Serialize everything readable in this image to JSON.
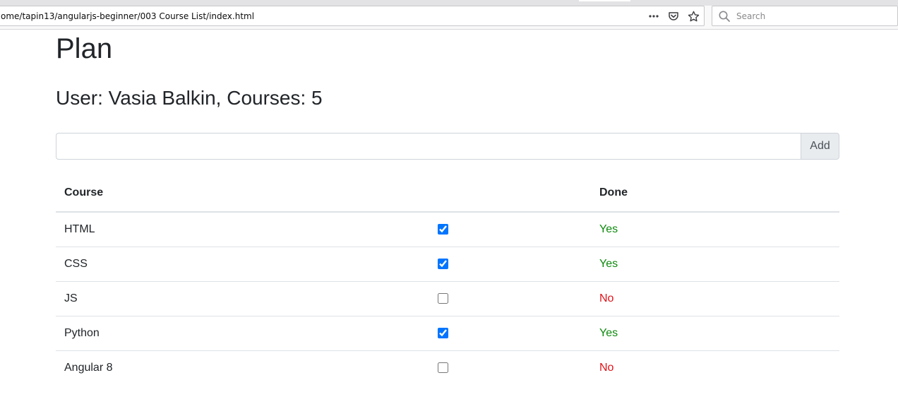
{
  "browser": {
    "url": "ome/tapin13/angularjs-beginner/003 Course List/index.html",
    "search_placeholder": "Search"
  },
  "page": {
    "title": "Plan",
    "user_line": "User: Vasia Balkin, Courses: 5",
    "new_course_value": "",
    "add_label": "Add"
  },
  "table": {
    "headers": {
      "course": "Course",
      "check": "",
      "done": "Done"
    },
    "rows": [
      {
        "course": "HTML",
        "checked": true,
        "done": "Yes"
      },
      {
        "course": "CSS",
        "checked": true,
        "done": "Yes"
      },
      {
        "course": "JS",
        "checked": false,
        "done": "No"
      },
      {
        "course": "Python",
        "checked": true,
        "done": "Yes"
      },
      {
        "course": "Angular 8",
        "checked": false,
        "done": "No"
      }
    ]
  },
  "colors": {
    "yes": "#0b8a0b",
    "no": "#e0131a"
  }
}
